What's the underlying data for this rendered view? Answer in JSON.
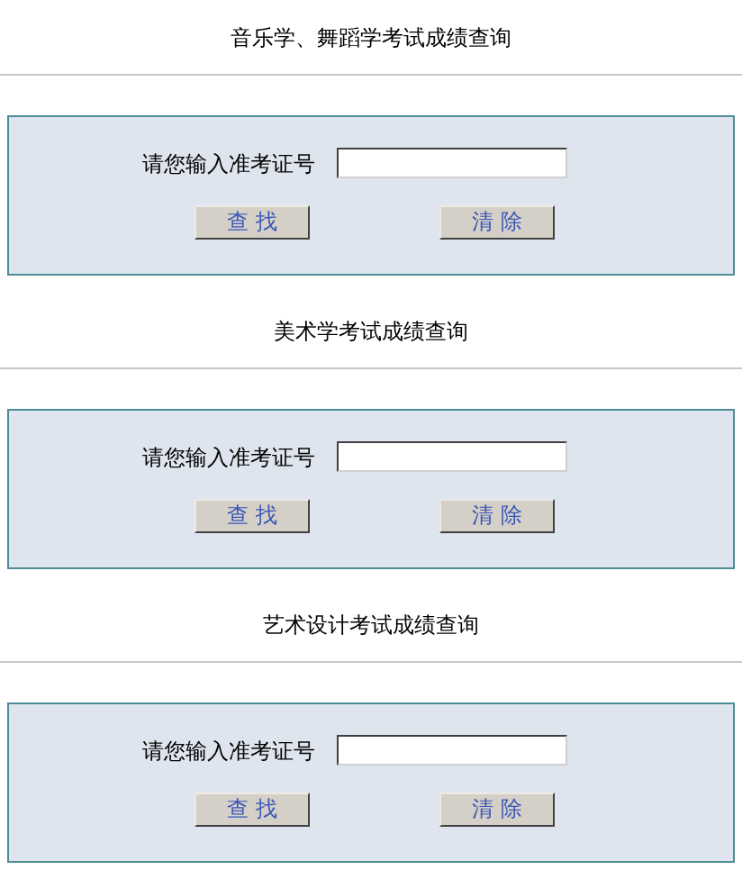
{
  "sections": [
    {
      "title": "音乐学、舞蹈学考试成绩查询",
      "field_label": "请您输入准考证号",
      "buttons": [
        "查 找",
        "清 除"
      ]
    },
    {
      "title": "美术学考试成绩查询",
      "field_label": "请您输入准考证号",
      "buttons": [
        "查 找",
        "清 除"
      ]
    },
    {
      "title": "艺术设计考试成绩查询",
      "field_label": "请您输入准考证号",
      "buttons": [
        "查 找",
        "清 除"
      ]
    }
  ]
}
